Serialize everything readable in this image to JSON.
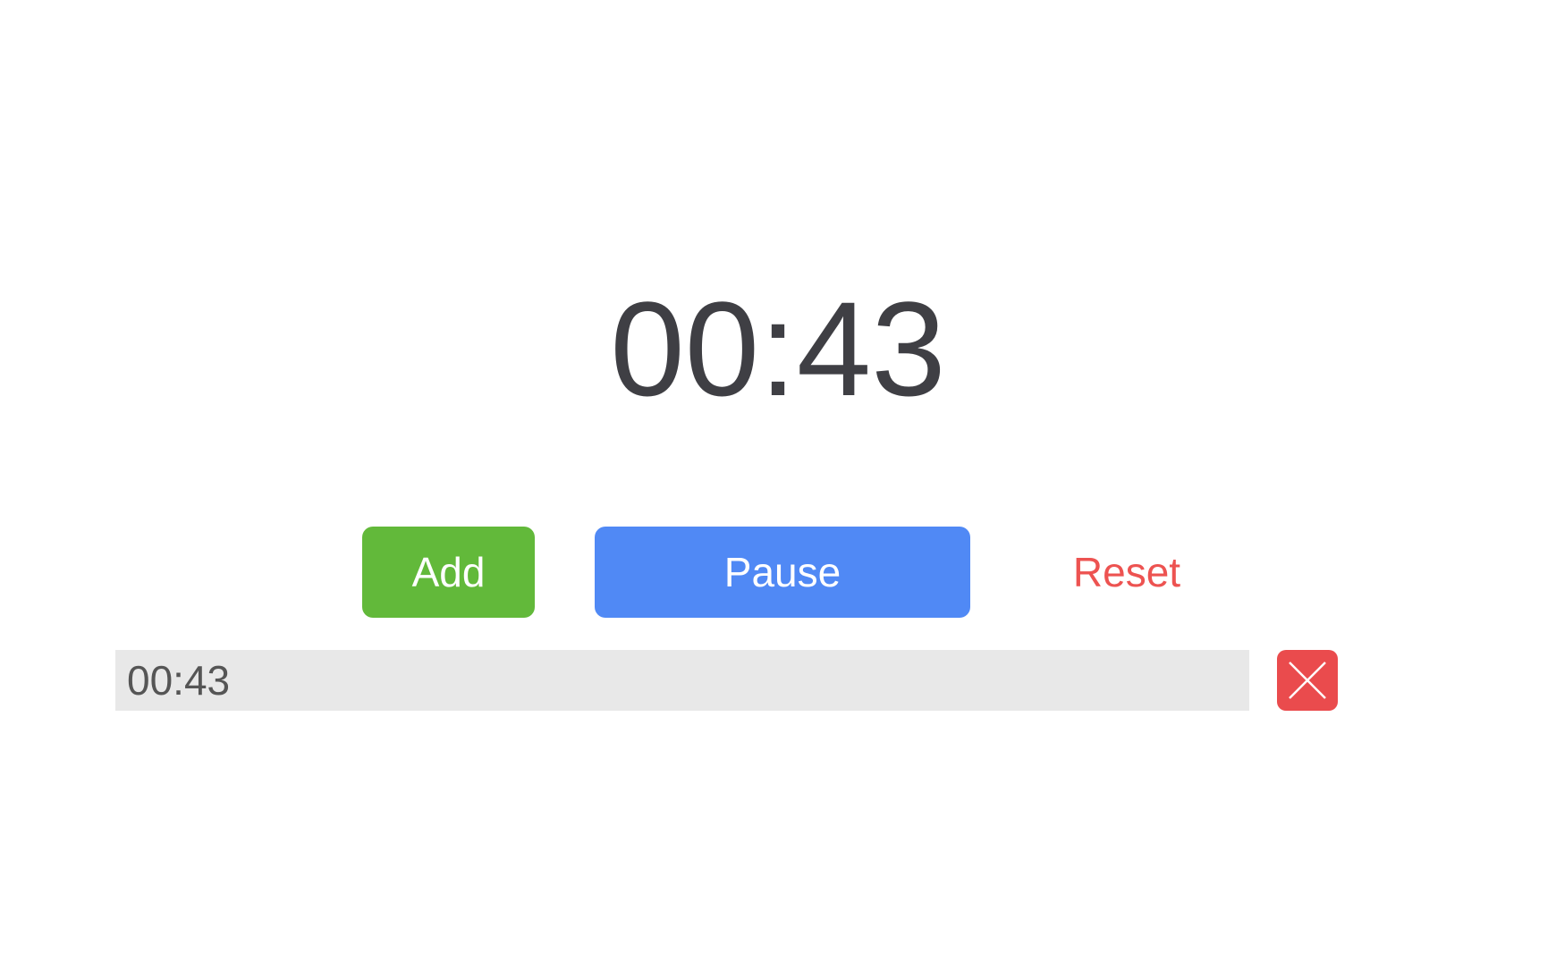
{
  "timer": {
    "display": "00:43"
  },
  "controls": {
    "add_label": "Add",
    "pause_label": "Pause",
    "reset_label": "Reset"
  },
  "laps": [
    {
      "time": "00:43",
      "delete_icon": "close-icon"
    }
  ],
  "colors": {
    "timer_text": "#3f3f44",
    "add_button": "#62b93a",
    "pause_button": "#5089f5",
    "reset_text": "#ed5351",
    "lap_background": "#e8e8e8",
    "lap_text": "#555555",
    "delete_button": "#ea4b4d"
  }
}
